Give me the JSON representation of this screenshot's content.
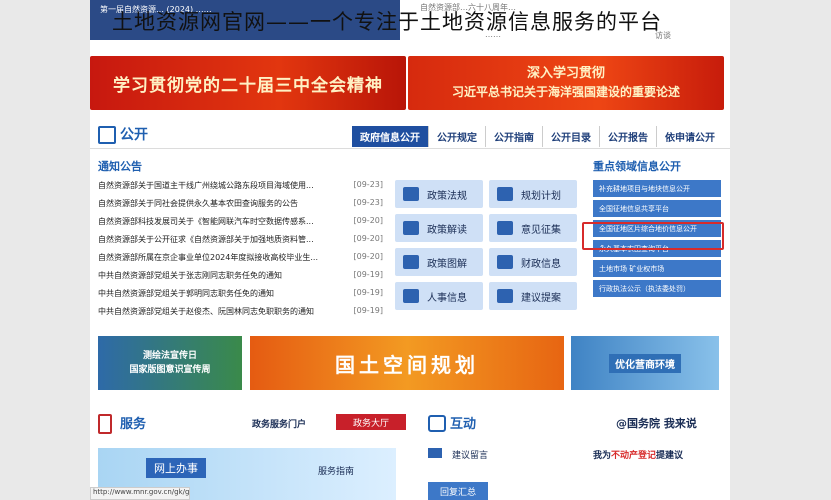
{
  "caption": "土地资源网官网——一个专注于土地资源信息服务的平台",
  "top": {
    "news_left": "第一届自然资源…  (2024)  ……",
    "news_badge": "(2024)",
    "right_news_1": "自然资源部…六十八周年…",
    "right_news_2": "……",
    "right_news_3": "访谈"
  },
  "banners": {
    "left": "学习贯彻党的二十届三中全会精神",
    "right_line1": "深入学习贯彻",
    "right_line2": "习近平总书记关于海洋强国建设的重要论述"
  },
  "open_section": {
    "title": "公开",
    "tabs": [
      "政府信息公开",
      "公开规定",
      "公开指南",
      "公开目录",
      "公开报告",
      "依申请公开"
    ]
  },
  "notices": {
    "title": "通知公告",
    "items": [
      {
        "text": "自然资源部关于国道主干线广州绕城公路东段项目海域使用...",
        "date": "[09-23]"
      },
      {
        "text": "自然资源部关于同社会提供永久基本农田查询服务的公告",
        "date": "[09-23]"
      },
      {
        "text": "自然资源部科技发展司关于《智能网联汽车时空数据传感系...",
        "date": "[09-20]"
      },
      {
        "text": "自然资源部关于公开征求《自然资源部关于加强地质资料管...",
        "date": "[09-20]"
      },
      {
        "text": "自然资源部所属在京企事业单位2024年度拟接收高校毕业生...",
        "date": "[09-20]"
      },
      {
        "text": "中共自然资源部党组关于张志刚同志职务任免的通知",
        "date": "[09-19]"
      },
      {
        "text": "中共自然资源部党组关于郭明同志职务任免的通知",
        "date": "[09-19]"
      },
      {
        "text": "中共自然资源部党组关于赵俊杰、阮国林同志免职职务的通知",
        "date": "[09-19]"
      }
    ]
  },
  "quick_links": [
    "政策法规",
    "规划计划",
    "政策解读",
    "意见征集",
    "政策图解",
    "财政信息",
    "人事信息",
    "建议提案"
  ],
  "focus": {
    "title": "重点领域信息公开",
    "items": [
      "补充耕地项目与地块信息公开",
      "全国征地信息共享平台",
      "全国征地区片综合地价信息公开",
      "永久基本农田查询平台",
      "土地市场      矿业权市场",
      "行政执法公示（执法委处罚）"
    ]
  },
  "promos": {
    "p1_line1": "测绘法宣传日",
    "p1_line2": "国家版图意识宣传周",
    "p2": "国土空间规划",
    "p3": "优化营商环境"
  },
  "service": {
    "title": "服务",
    "portal": "政务服务门户",
    "hall": "政务大厅",
    "online": "网上办事",
    "guide": "服务指南"
  },
  "interaction": {
    "title": "互动",
    "gwy": "@国务院 我来说",
    "message": "建议留言",
    "suggest_prefix": "我为",
    "suggest_em": "不动产登记",
    "suggest_suffix": "提建议",
    "reply": "回复汇总"
  },
  "url": "http://www.mnr.gov.cn/gk/ghjh/"
}
